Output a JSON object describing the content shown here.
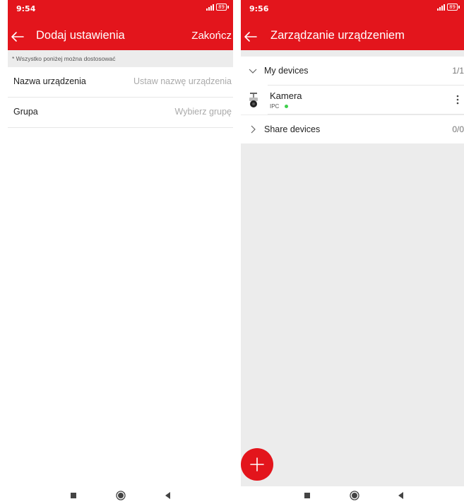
{
  "colors": {
    "accent": "#e3151c",
    "online": "#3ecf4c",
    "background_gray": "#ececec"
  },
  "left_screen": {
    "status": {
      "time": "9:54",
      "battery": "89"
    },
    "header": {
      "back_icon": "arrow-left-icon",
      "title": "Dodaj ustawienia",
      "action_label": "Zakończ"
    },
    "hint": "* Wszystko poniżej można dostosować",
    "form": [
      {
        "label": "Nazwa urządzenia",
        "placeholder": "Ustaw nazwę urządzenia"
      },
      {
        "label": "Grupa",
        "placeholder": "Wybierz grupę"
      }
    ]
  },
  "right_screen": {
    "status": {
      "time": "9:56",
      "battery": "89"
    },
    "header": {
      "back_icon": "arrow-left-icon",
      "title": "Zarządzanie urządzeniem"
    },
    "my_devices": {
      "label": "My devices",
      "count": "1/1",
      "expanded": true
    },
    "devices": [
      {
        "name": "Kamera",
        "type": "IPC",
        "online": true,
        "icon": "camera-icon"
      }
    ],
    "share_devices": {
      "label": "Share devices",
      "count": "0/0",
      "expanded": false
    },
    "fab_icon": "plus-icon"
  },
  "nav_bar": {
    "buttons": [
      "recent-apps-icon",
      "home-icon",
      "back-triangle-icon"
    ]
  }
}
